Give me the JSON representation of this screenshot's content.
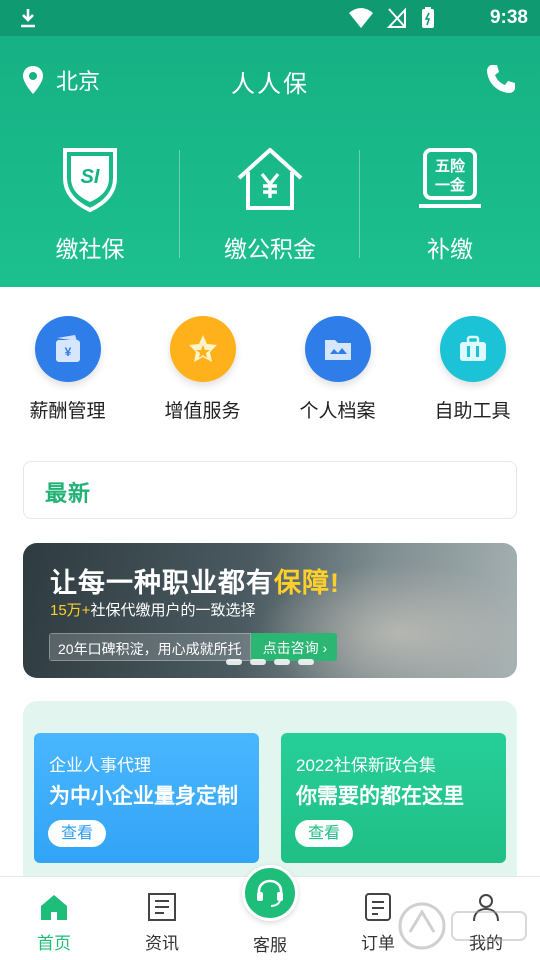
{
  "status_bar": {
    "time": "9:38"
  },
  "header": {
    "location": "北京",
    "title": "人人保",
    "actions": [
      {
        "label": "缴社保",
        "icon": "si-shield-icon"
      },
      {
        "label": "缴公积金",
        "icon": "house-yen-icon"
      },
      {
        "label": "补缴",
        "icon": "five-insurances-icon",
        "badge_line1": "五险",
        "badge_line2": "一金"
      }
    ]
  },
  "tools": [
    {
      "label": "薪酬管理",
      "icon": "wallet-icon",
      "color": "#2f7de8"
    },
    {
      "label": "增值服务",
      "icon": "star-badge-icon",
      "color": "#ffb11b"
    },
    {
      "label": "个人档案",
      "icon": "folder-icon",
      "color": "#2f7de8"
    },
    {
      "label": "自助工具",
      "icon": "toolbox-icon",
      "color": "#1cc3d6"
    }
  ],
  "latest": {
    "tag": "最新"
  },
  "banner": {
    "headline_main": "让每一种职业都有",
    "headline_highlight": "保障!",
    "sub_number": "15万+",
    "sub_text": "社保代缴用户的一致选择",
    "pill_text": "20年口碑积淀，用心成就所托",
    "pill_button": "点击咨询 ›"
  },
  "cards": [
    {
      "line1": "企业人事代理",
      "line2": "为中小企业量身定制",
      "button": "查看"
    },
    {
      "line1": "2022社保新政合集",
      "line2": "你需要的都在这里",
      "button": "查看"
    }
  ],
  "tabbar": [
    {
      "label": "首页",
      "icon": "home-icon",
      "active": true
    },
    {
      "label": "资讯",
      "icon": "news-icon"
    },
    {
      "label": "客服",
      "icon": "headset-icon"
    },
    {
      "label": "订单",
      "icon": "order-icon"
    },
    {
      "label": "我的",
      "icon": "person-icon"
    }
  ],
  "colors": {
    "brand_green": "#1ebd7a",
    "header_green": "#16b184",
    "highlight_yellow": "#ffcf2a"
  }
}
